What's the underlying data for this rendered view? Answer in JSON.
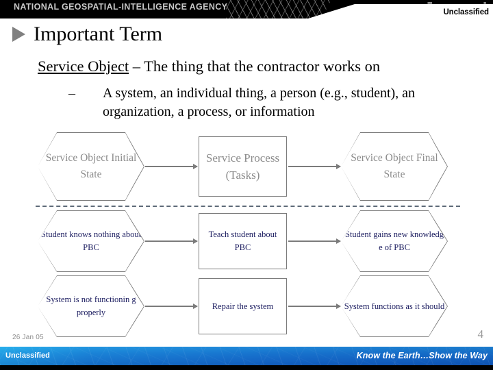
{
  "header": {
    "agency_name": "NATIONAL GEOSPATIAL-INTELLIGENCE AGENCY",
    "classification": "Unclassified",
    "mark_1": "≡≡",
    "mark_2": "≡"
  },
  "title": {
    "text": "Important Term",
    "bullet_icon": "triangle-right-icon"
  },
  "bullets": {
    "level1_term": "Service Object",
    "level1_rest": " – The thing that the contractor works on",
    "level2_dash": "–",
    "level2_text": "A system, an individual thing, a person (e.g., student), an organization, a process, or information"
  },
  "diagram": {
    "rows": [
      {
        "style": "gray",
        "start": "Service Object Initial State",
        "process": "Service Process (Tasks)",
        "end": "Service Object Final State"
      },
      {
        "style": "navy",
        "start": "Student knows nothing about PBC",
        "process": "Teach student about PBC",
        "end": "Student gains new knowledg e of PBC"
      },
      {
        "style": "navy",
        "start": "System is not functionin g properly",
        "process": "Repair the system",
        "end": "System functions as it should"
      }
    ]
  },
  "footer": {
    "date": "26 Jan 05",
    "page_number": "4",
    "classification": "Unclassified",
    "tagline": "Know the Earth…Show the Way"
  },
  "colors": {
    "header_bg": "#000000",
    "gray_text": "#8c8c8c",
    "navy_text": "#1f2062",
    "shape_border": "#7b7b7b",
    "footer_blue": "#1a7fd4",
    "divider": "#5e6a78"
  }
}
